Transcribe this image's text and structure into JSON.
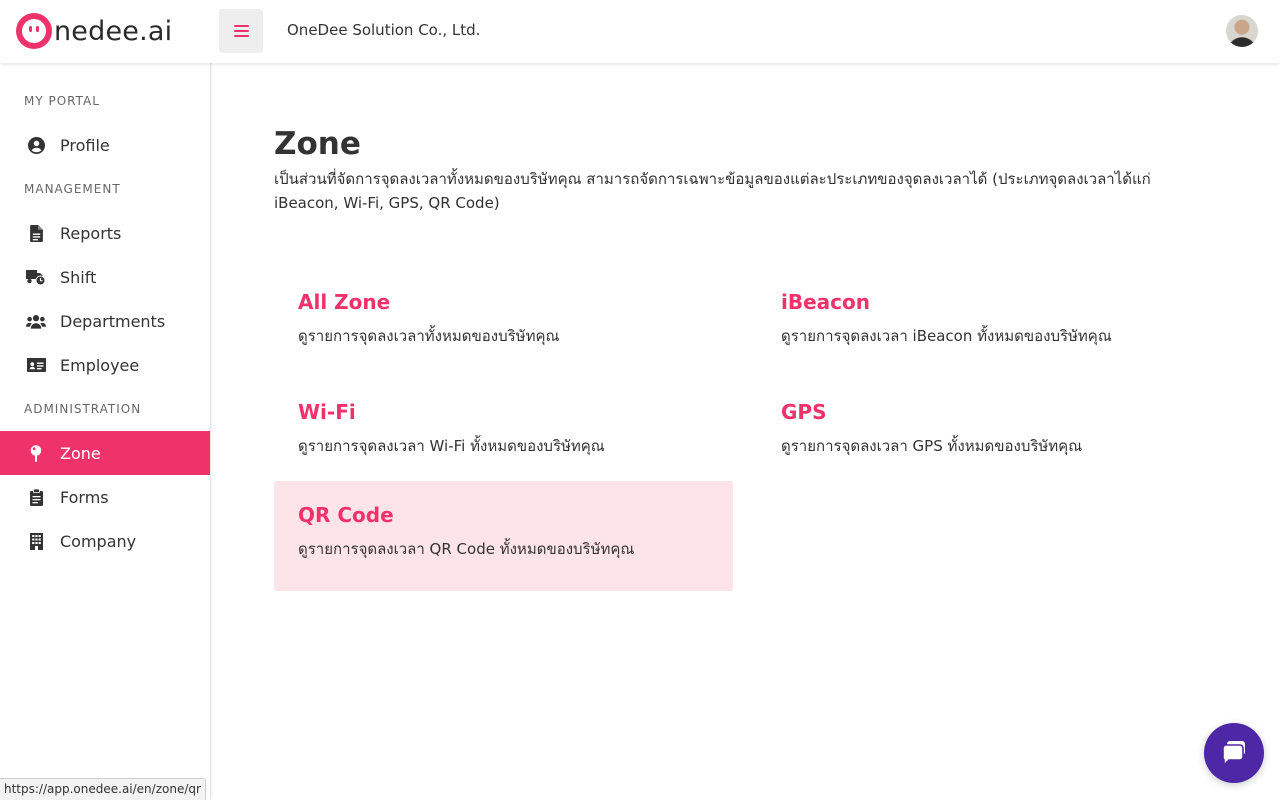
{
  "header": {
    "logo_text": "nedee.ai",
    "company_name": "OneDee Solution Co., Ltd."
  },
  "sidebar": {
    "sections": {
      "my_portal": "MY PORTAL",
      "management": "MANAGEMENT",
      "administration": "ADMINISTRATION"
    },
    "items": {
      "profile": "Profile",
      "reports": "Reports",
      "shift": "Shift",
      "departments": "Departments",
      "employee": "Employee",
      "zone": "Zone",
      "forms": "Forms",
      "company": "Company"
    },
    "active_item": "Zone"
  },
  "main": {
    "title": "Zone",
    "description": "เป็นส่วนที่จัดการจุดลงเวลาทั้งหมดของบริษัทคุณ สามารถจัดการเฉพาะข้อมูลของแต่ละประเภทของจุดลงเวลาได้ (ประเภทจุดลงเวลาได้แก่ iBeacon, Wi-Fi, GPS, QR Code)",
    "cards": [
      {
        "title": "All Zone",
        "description": "ดูรายการจุดลงเวลาทั้งหมดของบริษัทคุณ"
      },
      {
        "title": "iBeacon",
        "description": "ดูรายการจุดลงเวลา iBeacon ทั้งหมดของบริษัทคุณ"
      },
      {
        "title": "Wi-Fi",
        "description": "ดูรายการจุดลงเวลา Wi-Fi ทั้งหมดของบริษัทคุณ"
      },
      {
        "title": "GPS",
        "description": "ดูรายการจุดลงเวลา GPS ทั้งหมดของบริษัทคุณ"
      },
      {
        "title": "QR Code",
        "description": "ดูรายการจุดลงเวลา QR Code ทั้งหมดของบริษัทคุณ"
      }
    ]
  },
  "status_bar": {
    "url": "https://app.onedee.ai/en/zone/qr"
  },
  "colors": {
    "accent": "#f0326a",
    "highlight": "#fde4e9",
    "chat": "#4d27a6"
  },
  "icons": [
    "menu-icon",
    "user-circle-icon",
    "file-icon",
    "truck-clock-icon",
    "users-icon",
    "id-card-icon",
    "map-pin-icon",
    "clipboard-icon",
    "building-icon",
    "chat-icon"
  ]
}
